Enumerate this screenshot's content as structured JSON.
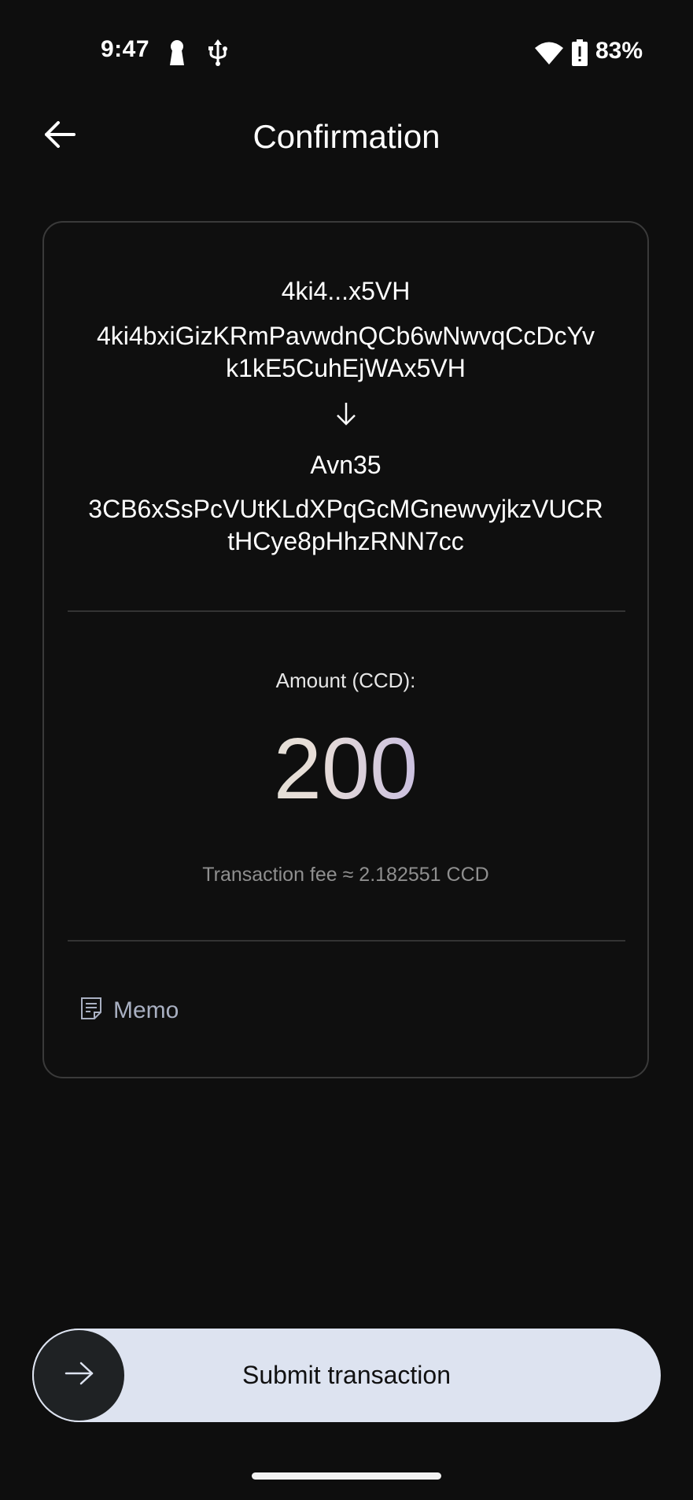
{
  "status_bar": {
    "time": "9:47",
    "battery_percent": "83%",
    "icons": [
      "keyhole-icon",
      "usb-icon",
      "wifi-icon",
      "battery-icon"
    ]
  },
  "header": {
    "title": "Confirmation",
    "back_icon": "arrow-left-icon"
  },
  "transfer": {
    "sender_short": "4ki4...x5VH",
    "sender_address_lines": [
      "4ki4bxiGizKRmPavwdnQCb6wNwvqCcDcYv",
      "k1kE5CuhEjWAx5VH"
    ],
    "direction_icon": "arrow-down-icon",
    "recipient_name": "Avn35",
    "recipient_address_lines": [
      "3CB6xSsPcVUtKLdXPqGcMGnewvyjkzVUCR",
      "tHCye8pHhzRNN7cc"
    ]
  },
  "amount": {
    "label": "Amount (CCD):",
    "value": "200",
    "fee_text": "Transaction fee ≈ 2.182551 CCD"
  },
  "memo": {
    "label": "Memo",
    "icon": "note-icon"
  },
  "submit": {
    "label": "Submit transaction",
    "thumb_icon": "arrow-right-icon"
  },
  "colors": {
    "background": "#0e0e0e",
    "card_border": "#3a3a3a",
    "slider_track": "#dde3f0",
    "slider_thumb": "#1f2224",
    "fee_text": "#8f8f8f",
    "memo_text": "#a9b0c2",
    "amount_gradient": [
      "#d4ecd6",
      "#e7ddd7",
      "#b4a9e6",
      "#9f97ea"
    ]
  }
}
